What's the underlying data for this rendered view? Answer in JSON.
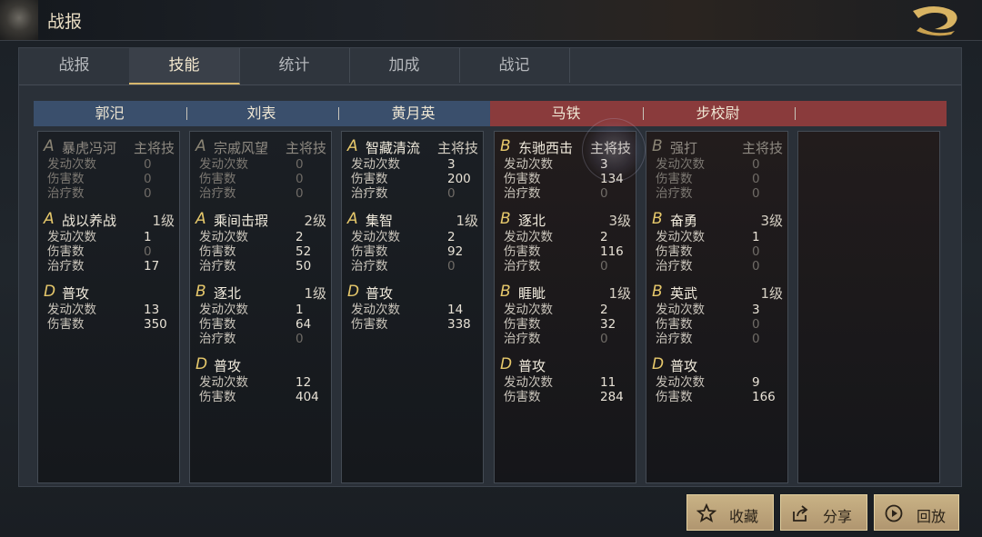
{
  "window": {
    "title": "战报"
  },
  "tabs": [
    "战报",
    "技能",
    "统计",
    "加成",
    "战记"
  ],
  "active_tab": 1,
  "generals": [
    {
      "name": "郭汜",
      "side": "blue",
      "skills": [
        {
          "grade": "A",
          "name": "暴虎冯河",
          "level": "主将技",
          "dim": true,
          "stats": [
            {
              "label": "发动次数",
              "value": "0"
            },
            {
              "label": "伤害数",
              "value": "0"
            },
            {
              "label": "治疗数",
              "value": "0"
            }
          ]
        },
        {
          "grade": "A",
          "name": "战以养战",
          "level": "1级",
          "dim": false,
          "stats": [
            {
              "label": "发动次数",
              "value": "1"
            },
            {
              "label": "伤害数",
              "value": "0"
            },
            {
              "label": "治疗数",
              "value": "17"
            }
          ]
        },
        {
          "grade": "D",
          "name": "普攻",
          "level": "",
          "dim": false,
          "stats": [
            {
              "label": "发动次数",
              "value": "13"
            },
            {
              "label": "伤害数",
              "value": "350"
            }
          ]
        }
      ]
    },
    {
      "name": "刘表",
      "side": "blue",
      "skills": [
        {
          "grade": "A",
          "name": "宗戚风望",
          "level": "主将技",
          "dim": true,
          "stats": [
            {
              "label": "发动次数",
              "value": "0"
            },
            {
              "label": "伤害数",
              "value": "0"
            },
            {
              "label": "治疗数",
              "value": "0"
            }
          ]
        },
        {
          "grade": "A",
          "name": "乘间击瑕",
          "level": "2级",
          "dim": false,
          "stats": [
            {
              "label": "发动次数",
              "value": "2"
            },
            {
              "label": "伤害数",
              "value": "52"
            },
            {
              "label": "治疗数",
              "value": "50"
            }
          ]
        },
        {
          "grade": "B",
          "name": "逐北",
          "level": "1级",
          "dim": false,
          "stats": [
            {
              "label": "发动次数",
              "value": "1"
            },
            {
              "label": "伤害数",
              "value": "64"
            },
            {
              "label": "治疗数",
              "value": "0"
            }
          ]
        },
        {
          "grade": "D",
          "name": "普攻",
          "level": "",
          "dim": false,
          "stats": [
            {
              "label": "发动次数",
              "value": "12"
            },
            {
              "label": "伤害数",
              "value": "404"
            }
          ]
        }
      ]
    },
    {
      "name": "黄月英",
      "side": "blue",
      "skills": [
        {
          "grade": "A",
          "name": "智藏清流",
          "level": "主将技",
          "dim": false,
          "stats": [
            {
              "label": "发动次数",
              "value": "3"
            },
            {
              "label": "伤害数",
              "value": "200"
            },
            {
              "label": "治疗数",
              "value": "0"
            }
          ]
        },
        {
          "grade": "A",
          "name": "集智",
          "level": "1级",
          "dim": false,
          "stats": [
            {
              "label": "发动次数",
              "value": "2"
            },
            {
              "label": "伤害数",
              "value": "92"
            },
            {
              "label": "治疗数",
              "value": "0"
            }
          ]
        },
        {
          "grade": "D",
          "name": "普攻",
          "level": "",
          "dim": false,
          "stats": [
            {
              "label": "发动次数",
              "value": "14"
            },
            {
              "label": "伤害数",
              "value": "338"
            }
          ]
        }
      ]
    },
    {
      "name": "马铁",
      "side": "red",
      "skills": [
        {
          "grade": "B",
          "name": "东驰西击",
          "level": "主将技",
          "dim": false,
          "stats": [
            {
              "label": "发动次数",
              "value": "3"
            },
            {
              "label": "伤害数",
              "value": "134"
            },
            {
              "label": "治疗数",
              "value": "0"
            }
          ]
        },
        {
          "grade": "B",
          "name": "逐北",
          "level": "3级",
          "dim": false,
          "stats": [
            {
              "label": "发动次数",
              "value": "2"
            },
            {
              "label": "伤害数",
              "value": "116"
            },
            {
              "label": "治疗数",
              "value": "0"
            }
          ]
        },
        {
          "grade": "B",
          "name": "睚眦",
          "level": "1级",
          "dim": false,
          "stats": [
            {
              "label": "发动次数",
              "value": "2"
            },
            {
              "label": "伤害数",
              "value": "32"
            },
            {
              "label": "治疗数",
              "value": "0"
            }
          ]
        },
        {
          "grade": "D",
          "name": "普攻",
          "level": "",
          "dim": false,
          "stats": [
            {
              "label": "发动次数",
              "value": "11"
            },
            {
              "label": "伤害数",
              "value": "284"
            }
          ]
        }
      ]
    },
    {
      "name": "步校尉",
      "side": "red",
      "skills": [
        {
          "grade": "B",
          "name": "强打",
          "level": "主将技",
          "dim": true,
          "stats": [
            {
              "label": "发动次数",
              "value": "0"
            },
            {
              "label": "伤害数",
              "value": "0"
            },
            {
              "label": "治疗数",
              "value": "0"
            }
          ]
        },
        {
          "grade": "B",
          "name": "奋勇",
          "level": "3级",
          "dim": false,
          "stats": [
            {
              "label": "发动次数",
              "value": "1"
            },
            {
              "label": "伤害数",
              "value": "0"
            },
            {
              "label": "治疗数",
              "value": "0"
            }
          ]
        },
        {
          "grade": "B",
          "name": "英武",
          "level": "1级",
          "dim": false,
          "stats": [
            {
              "label": "发动次数",
              "value": "3"
            },
            {
              "label": "伤害数",
              "value": "0"
            },
            {
              "label": "治疗数",
              "value": "0"
            }
          ]
        },
        {
          "grade": "D",
          "name": "普攻",
          "level": "",
          "dim": false,
          "stats": [
            {
              "label": "发动次数",
              "value": "9"
            },
            {
              "label": "伤害数",
              "value": "166"
            }
          ]
        }
      ]
    },
    {
      "name": "",
      "side": "red",
      "skills": []
    }
  ],
  "buttons": {
    "collect": "收藏",
    "share": "分享",
    "replay": "回放"
  },
  "colors": {
    "blue_header": "#3a4f6c",
    "red_header": "#8a3b3c",
    "accent": "#d7b76c"
  }
}
